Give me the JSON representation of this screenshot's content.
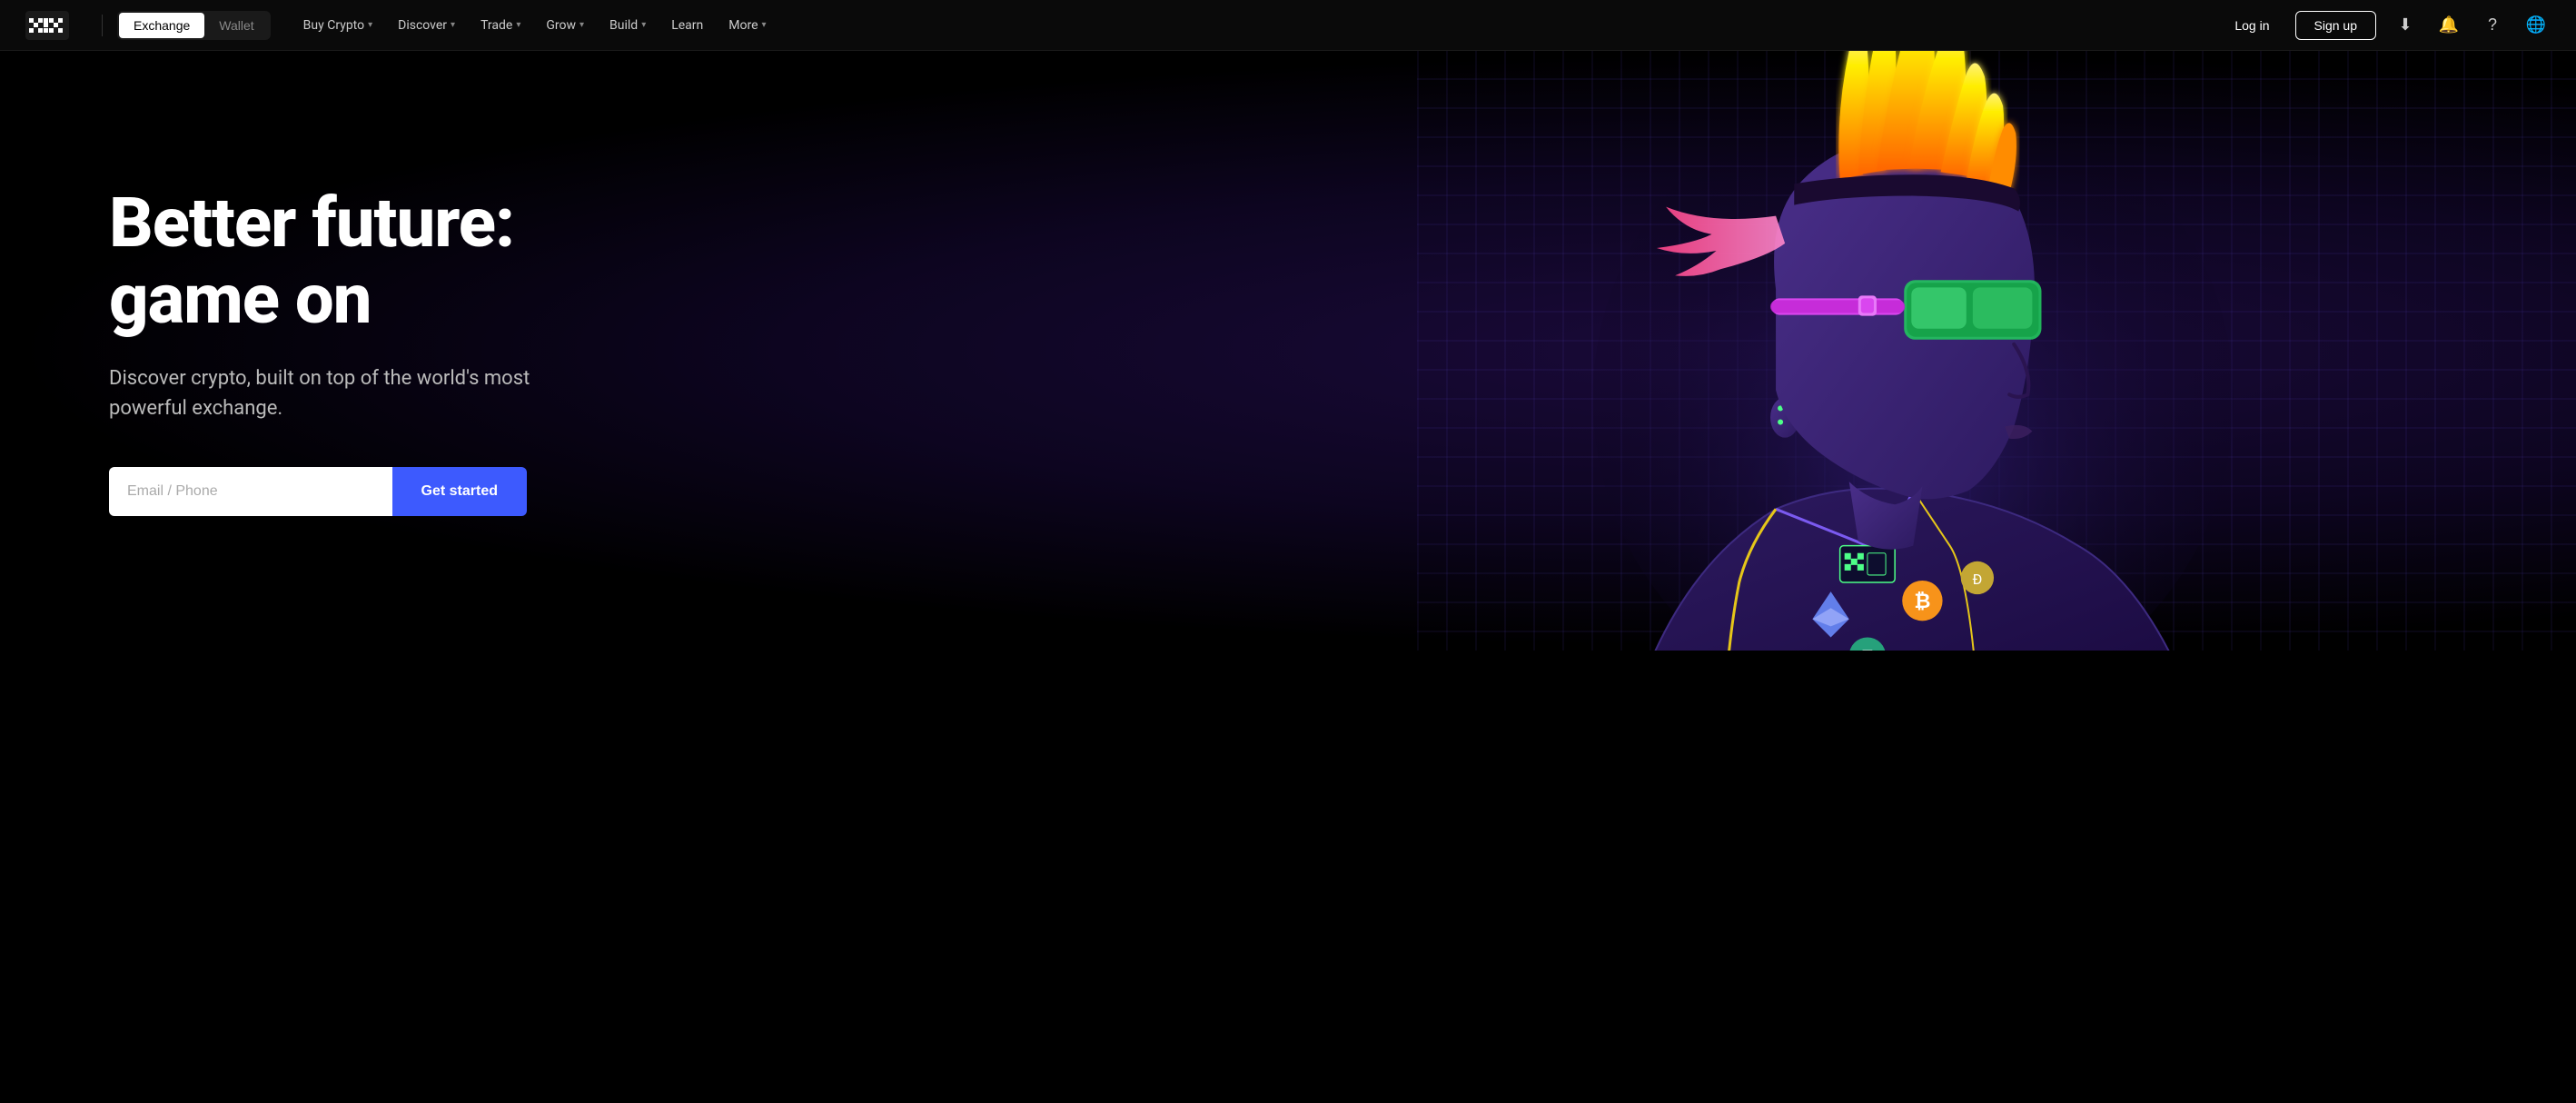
{
  "brand": {
    "name": "OKX"
  },
  "navbar": {
    "mode_exchange": "Exchange",
    "mode_wallet": "Wallet",
    "nav_items": [
      {
        "label": "Buy Crypto",
        "has_dropdown": true
      },
      {
        "label": "Discover",
        "has_dropdown": true
      },
      {
        "label": "Trade",
        "has_dropdown": true
      },
      {
        "label": "Grow",
        "has_dropdown": true
      },
      {
        "label": "Build",
        "has_dropdown": true
      },
      {
        "label": "Learn",
        "has_dropdown": false
      },
      {
        "label": "More",
        "has_dropdown": true
      }
    ],
    "login_label": "Log in",
    "signup_label": "Sign up"
  },
  "hero": {
    "title_line1": "Better future:",
    "title_line2": "game on",
    "subtitle": "Discover crypto, built on top of the world's most powerful exchange.",
    "input_placeholder": "Email / Phone",
    "cta_label": "Get started"
  }
}
